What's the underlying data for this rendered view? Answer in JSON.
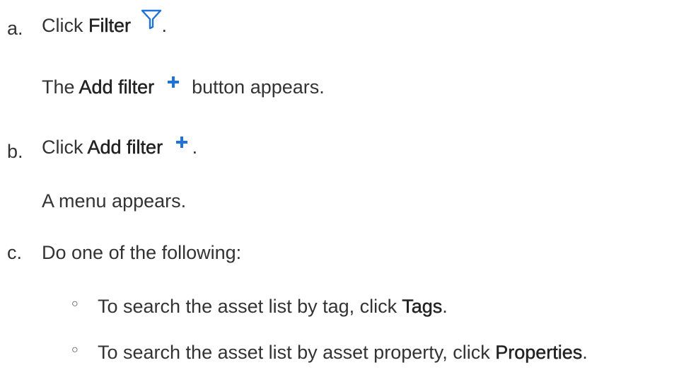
{
  "steps": [
    {
      "marker": "a.",
      "pre": "Click ",
      "bold": "Filter",
      "icon": "filter-icon",
      "post": ".",
      "result": {
        "pre": "The ",
        "bold": "Add filter",
        "icon": "plus-icon",
        "post": " button appears."
      }
    },
    {
      "marker": "b.",
      "pre": "Click ",
      "bold": "Add filter",
      "icon": "plus-icon",
      "post": ".",
      "result": {
        "text": "A menu appears."
      }
    },
    {
      "marker": "c.",
      "text": "Do one of the following:",
      "bullets": [
        {
          "symbol": "○",
          "pre": "To search the asset list by tag, click ",
          "bold": "Tags",
          "post": "."
        },
        {
          "symbol": "○",
          "pre": "To search the asset list by asset property, click ",
          "bold": "Properties",
          "post": "."
        }
      ]
    }
  ],
  "colors": {
    "filter_icon": "#1e73d8",
    "plus_icon": "#1e73d8",
    "text": "#333333"
  }
}
